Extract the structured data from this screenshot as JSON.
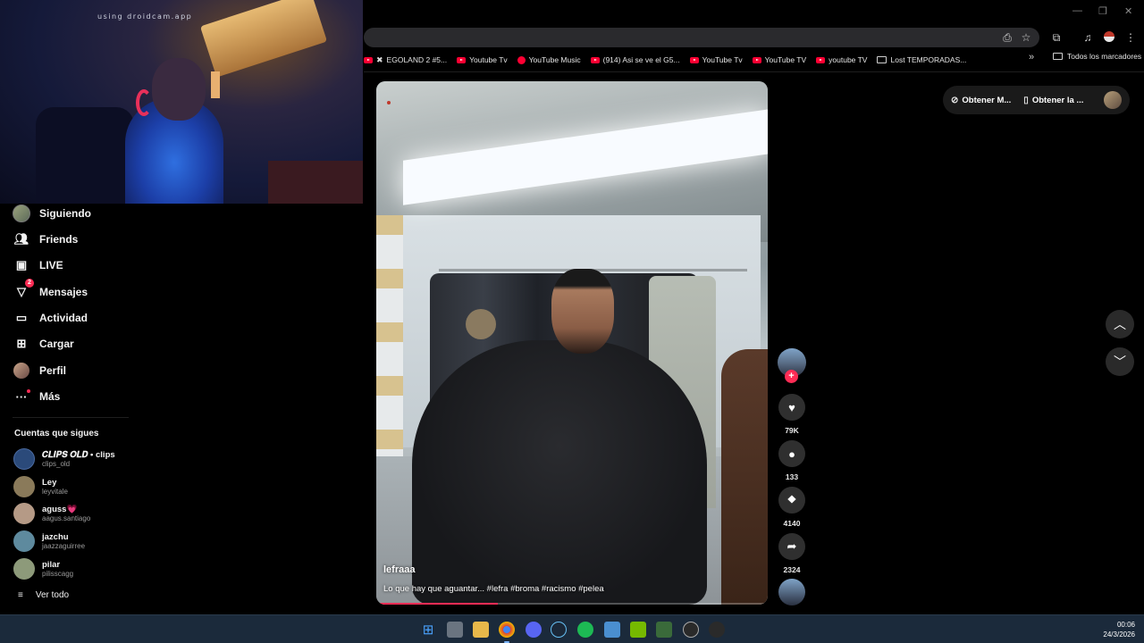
{
  "webcam": {
    "label": "using droidcam.app"
  },
  "window_controls": {
    "minimize": "—",
    "restore": "❐",
    "close": "✕"
  },
  "browser": {
    "bookmarks": [
      {
        "label": "EGOLAND 2 #5...",
        "icon": "x-icon"
      },
      {
        "label": "Youtube Tv",
        "icon": "youtube-icon"
      },
      {
        "label": "YouTube Music",
        "icon": "youtube-music-icon"
      },
      {
        "label": "(914) Asi se ve el G5...",
        "icon": "youtube-icon"
      },
      {
        "label": "YouTube Tv",
        "icon": "youtube-icon"
      },
      {
        "label": "YouTube TV",
        "icon": "youtube-icon"
      },
      {
        "label": "youtube TV",
        "icon": "youtube-icon"
      },
      {
        "label": "Lost TEMPORADAS...",
        "icon": "page-icon"
      }
    ],
    "more": "»",
    "all_bookmarks": "Todos los marcadores"
  },
  "sidebar": {
    "items": [
      {
        "label": "Siguiendo",
        "icon": "following-avatar-icon"
      },
      {
        "label": "Friends",
        "icon": "friends-icon"
      },
      {
        "label": "LIVE",
        "icon": "live-tv-icon"
      },
      {
        "label": "Mensajes",
        "icon": "messages-icon",
        "badge": "2"
      },
      {
        "label": "Actividad",
        "icon": "activity-icon"
      },
      {
        "label": "Cargar",
        "icon": "upload-icon"
      },
      {
        "label": "Perfil",
        "icon": "profile-avatar-icon"
      },
      {
        "label": "Más",
        "icon": "more-icon"
      }
    ],
    "following_title": "Cuentas que sigues",
    "following": [
      {
        "name": "𝑪𝑳𝑰𝑷𝑺 𝑶𝑳𝑫 • clips",
        "handle": "clips_old",
        "color": "#2b4a7a"
      },
      {
        "name": "Ley",
        "handle": "leyvitale",
        "color": "#8a7a5a"
      },
      {
        "name": "aguss💗",
        "handle": "aagus.santiago",
        "color": "#b59a86"
      },
      {
        "name": "jazchu",
        "handle": "jaazzaguirree",
        "color": "#5e8a9e"
      },
      {
        "name": "pilar",
        "handle": "pilisscagg",
        "color": "#8d9a7a"
      }
    ],
    "see_all": "Ver todo"
  },
  "video": {
    "author": "lefraaa",
    "description": "Lo que hay que aguantar... #lefra #broma #racismo #pelea",
    "progress": 0.31
  },
  "actions": {
    "likes": "79K",
    "comments": "133",
    "saves": "4140",
    "shares": "2324"
  },
  "top_pill": {
    "coins": "Obtener M...",
    "app": "Obtener la ..."
  },
  "taskbar": {
    "time": "00:06",
    "date": "24/3/2026"
  }
}
